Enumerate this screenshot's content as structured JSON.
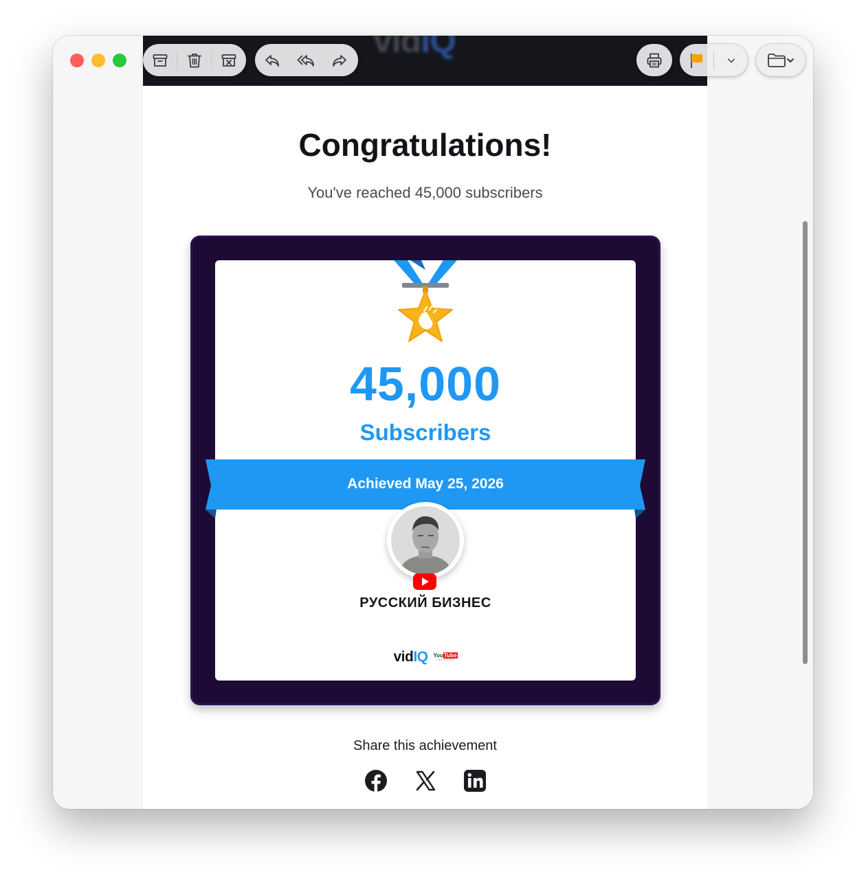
{
  "toolbar": {
    "buttons": [
      "archive-icon",
      "trash-icon",
      "junk-icon",
      "reply-icon",
      "reply-all-icon",
      "forward-icon",
      "print-icon",
      "flag-icon",
      "chevron-down-icon",
      "folder-icon"
    ],
    "flag_color": "#f5a100"
  },
  "email": {
    "header_logo_a": "vid",
    "header_logo_b": "IQ",
    "title": "Congratulations!",
    "subtitle": "You've reached 45,000 subscribers",
    "card": {
      "count": "45,000",
      "count_label": "Subscribers",
      "achieved": "Achieved May 25, 2026",
      "channel_name": "РУССКИЙ БИЗНЕС",
      "brand_a": "vid",
      "brand_b": "IQ",
      "yt_you": "You",
      "yt_tube": "Tube",
      "yt_certified": "CERTIFIED"
    },
    "share_label": "Share this achievement",
    "share_icons": [
      "facebook-icon",
      "x-icon",
      "linkedin-icon"
    ]
  },
  "colors": {
    "accent": "#1f98f4",
    "card_frame": "#1d0b36",
    "medal_gold": "#f7b419"
  }
}
